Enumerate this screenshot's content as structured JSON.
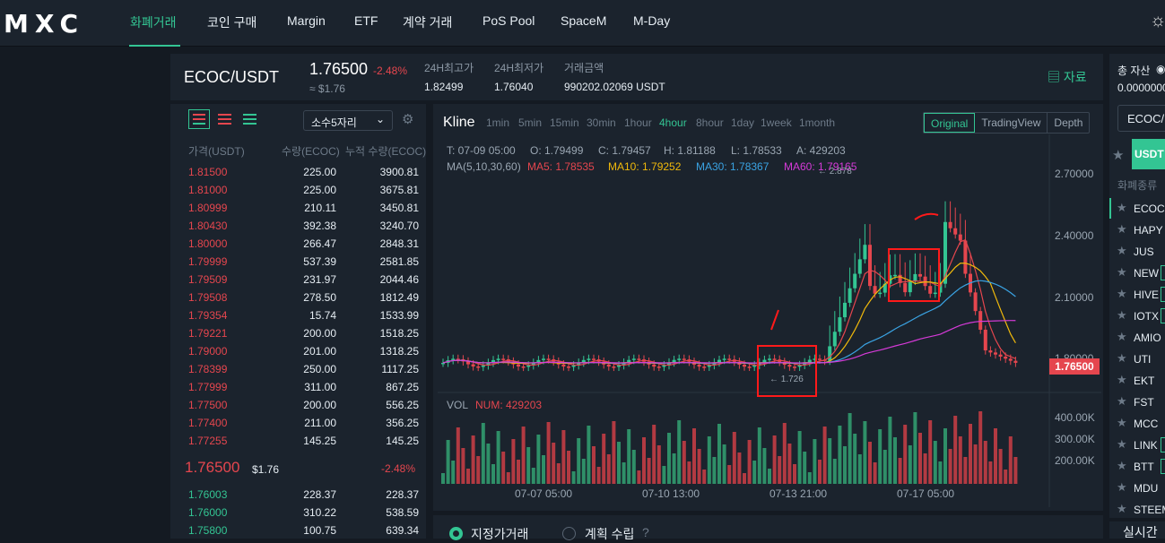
{
  "nav": {
    "logo": "MXC",
    "items": [
      "화폐거래",
      "코인 구매",
      "Margin",
      "ETF",
      "계약 거래",
      "PoS Pool",
      "SpaceM",
      "M-Day"
    ]
  },
  "ticker": {
    "pair": "ECOC/USDT",
    "price": "1.76500",
    "change": "-2.48%",
    "approx": "≈ $1.76",
    "stats": [
      {
        "label": "24H최고가",
        "value": "1.82499"
      },
      {
        "label": "24H최저가",
        "value": "1.76040"
      },
      {
        "label": "거래금액",
        "value": "990202.02069 USDT"
      }
    ],
    "info_link": "자료"
  },
  "orderbook": {
    "decimals": "소수5자리",
    "headers": [
      "가격(USDT)",
      "수량(ECOC)",
      "누적 수량(ECOC)"
    ],
    "asks": [
      [
        "1.81500",
        "225.00",
        "3900.81"
      ],
      [
        "1.81000",
        "225.00",
        "3675.81"
      ],
      [
        "1.80999",
        "210.11",
        "3450.81"
      ],
      [
        "1.80430",
        "392.38",
        "3240.70"
      ],
      [
        "1.80000",
        "266.47",
        "2848.31"
      ],
      [
        "1.79999",
        "537.39",
        "2581.85"
      ],
      [
        "1.79509",
        "231.97",
        "2044.46"
      ],
      [
        "1.79508",
        "278.50",
        "1812.49"
      ],
      [
        "1.79354",
        "15.74",
        "1533.99"
      ],
      [
        "1.79221",
        "200.00",
        "1518.25"
      ],
      [
        "1.79000",
        "201.00",
        "1318.25"
      ],
      [
        "1.78399",
        "250.00",
        "1117.25"
      ],
      [
        "1.77999",
        "311.00",
        "867.25"
      ],
      [
        "1.77500",
        "200.00",
        "556.25"
      ],
      [
        "1.77400",
        "211.00",
        "356.25"
      ],
      [
        "1.77255",
        "145.25",
        "145.25"
      ]
    ],
    "mid": {
      "price": "1.76500",
      "usd": "$1.76",
      "change": "-2.48%"
    },
    "bids": [
      [
        "1.76003",
        "228.37",
        "228.37"
      ],
      [
        "1.76000",
        "310.22",
        "538.59"
      ],
      [
        "1.75800",
        "100.75",
        "639.34"
      ]
    ]
  },
  "kline": {
    "title": "Kline",
    "intervals": [
      "1min",
      "5min",
      "15min",
      "30min",
      "1hour",
      "4hour",
      "8hour",
      "1day",
      "1week",
      "1month"
    ],
    "active_interval": "4hour",
    "views": [
      "Original",
      "TradingView",
      "Depth"
    ],
    "active_view": "Original",
    "ohlc": {
      "t": "T: 07-09 05:00",
      "o": "O: 1.79499",
      "c": "C: 1.79457",
      "h": "H: 1.81188",
      "l": "L: 1.78533",
      "a": "A: 429203"
    },
    "ma": {
      "label": "MA(5,10,30,60)",
      "ma5": "MA5: 1.78535",
      "ma10": "MA10: 1.79252",
      "ma30": "MA30: 1.78367",
      "ma60": "MA60: 1.79165"
    },
    "colors": {
      "ma5": "#e5464e",
      "ma10": "#f0b90b",
      "ma30": "#3aa3e3",
      "ma60": "#d63ad8",
      "up": "#33c593",
      "down": "#e5464e"
    },
    "y_labels": [
      "2.70000",
      "2.40000",
      "2.10000",
      "1.80000"
    ],
    "last_price": "1.76500",
    "high_mark": "2.878",
    "low_mark": "1.726",
    "vol_label": "VOL",
    "num_label": "NUM: 429203",
    "vol_labels": [
      "400.00K",
      "300.00K",
      "200.00K"
    ],
    "time_labels": [
      "07-07 05:00",
      "07-10 13:00",
      "07-13 21:00",
      "07-17 05:00"
    ]
  },
  "order": {
    "options": [
      "지정가거래",
      "계획 수립"
    ]
  },
  "right": {
    "total_assets": "총 자산",
    "total_value": "0.0000000",
    "select": "ECOC/",
    "tab": "USDT",
    "type_label": "화폐종류",
    "bottom": "실시간",
    "coins": [
      "ECOC",
      "HAPY",
      "JUS",
      "NEW",
      "HIVE",
      "IOTX",
      "AMIO",
      "UTI",
      "EKT",
      "FST",
      "MCC",
      "LINK",
      "BTT",
      "MDU",
      "STEEM"
    ]
  }
}
